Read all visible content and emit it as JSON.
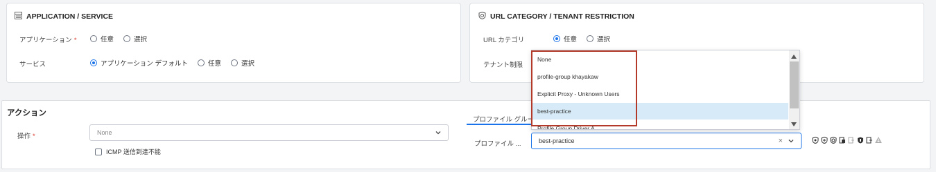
{
  "app_service": {
    "title": "APPLICATION / SERVICE",
    "application_label": "アプリケーション",
    "required_mark": "*",
    "application_options": [
      "任意",
      "選択"
    ],
    "service_label": "サービス",
    "service_options": [
      "アプリケーション デフォルト",
      "任意",
      "選択"
    ]
  },
  "url_category": {
    "title": "URL CATEGORY / TENANT RESTRICTION",
    "url_label": "URL カテゴリ",
    "url_options": [
      "任意",
      "選択"
    ],
    "tenant_label": "テナント制限"
  },
  "dropdown": {
    "items": [
      "None",
      "profile-group khayakaw",
      "Explicit Proxy - Unknown Users",
      "best-practice",
      "Profile Group Driver A"
    ]
  },
  "action": {
    "title": "アクション",
    "operation_label": "操作",
    "required_mark": "*",
    "operation_value": "None",
    "icmp_label": "ICMP 送信到達不能"
  },
  "profile": {
    "tab_label": "プロファイル グルー",
    "profile_label": "プロファイル ...",
    "profile_value": "best-practice",
    "clear_glyph": "×"
  },
  "colors": {
    "accent": "#1a73e8",
    "highlight": "#b33a28",
    "selected_row": "#d6ebf7"
  }
}
